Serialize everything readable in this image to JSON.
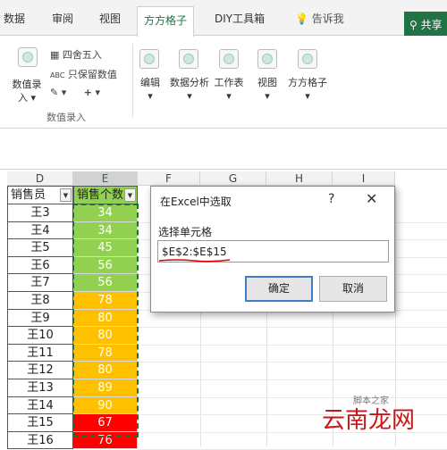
{
  "tabs": [
    {
      "label": "数据"
    },
    {
      "label": "审阅"
    },
    {
      "label": "视图"
    },
    {
      "label": "方方格子"
    },
    {
      "label": "DIY工具箱"
    }
  ],
  "tell_me": "告诉我",
  "share": "共享",
  "ribbon": {
    "data_entry": "数值录入",
    "round": "四舍五入",
    "keep_value": "只保留数值",
    "group_label": "数值录入",
    "edit": "编辑",
    "data_analysis": "数据分析",
    "worksheet": "工作表",
    "view": "视图",
    "fangfang": "方方格子",
    "abc": "ABC",
    "plus": "+"
  },
  "columns": [
    "D",
    "E",
    "F",
    "G",
    "H",
    "I"
  ],
  "headers": {
    "d": "销售员",
    "e": "销售个数"
  },
  "rows": [
    {
      "name": "王3",
      "value": "34",
      "color": "#92d050"
    },
    {
      "name": "王4",
      "value": "34",
      "color": "#92d050"
    },
    {
      "name": "王5",
      "value": "45",
      "color": "#92d050"
    },
    {
      "name": "王6",
      "value": "56",
      "color": "#92d050"
    },
    {
      "name": "王7",
      "value": "56",
      "color": "#92d050"
    },
    {
      "name": "王8",
      "value": "78",
      "color": "#ffc000"
    },
    {
      "name": "王9",
      "value": "80",
      "color": "#ffc000"
    },
    {
      "name": "王10",
      "value": "80",
      "color": "#ffc000"
    },
    {
      "name": "王11",
      "value": "78",
      "color": "#ffc000"
    },
    {
      "name": "王12",
      "value": "80",
      "color": "#ffc000"
    },
    {
      "name": "王13",
      "value": "89",
      "color": "#ffc000"
    },
    {
      "name": "王14",
      "value": "90",
      "color": "#ffc000"
    },
    {
      "name": "王15",
      "value": "67",
      "color": "#ff0000"
    },
    {
      "name": "王16",
      "value": "76",
      "color": "#ff0000"
    }
  ],
  "dialog": {
    "title": "在Excel中选取",
    "help": "?",
    "close": "✕",
    "label": "选择单元格",
    "value": "$E$2:$E$15",
    "ok": "确定",
    "cancel": "取消"
  },
  "watermark": {
    "main": "云南龙网",
    "sub": "脚本之家"
  }
}
